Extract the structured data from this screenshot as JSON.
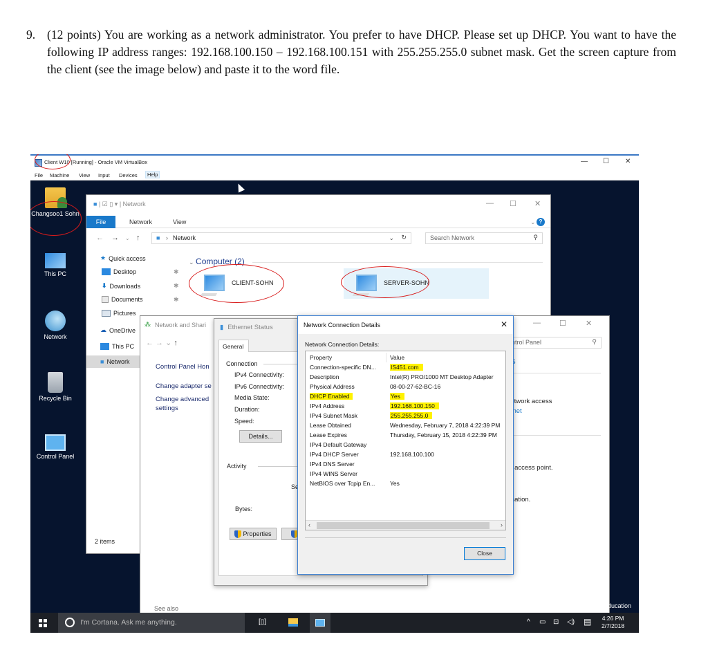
{
  "question": {
    "number": "9.",
    "text": "(12 points) You are working as a network administrator. You prefer to have DHCP. Please set up DHCP. You want to have the following IP address ranges: 192.168.100.150 – 192.168.100.151 with 255.255.255.0 subnet mask. Get the screen capture from the client (see the image below) and paste it to the word file."
  },
  "virtualbox": {
    "title": "Client W10 [Running] - Oracle VM VirtualBox",
    "menu": [
      "File",
      "Machine",
      "View",
      "Input",
      "Devices",
      "Help"
    ],
    "controls": {
      "minimize": "—",
      "maximize": "☐",
      "close": "✕"
    }
  },
  "desktop": {
    "icons": [
      {
        "label": "Changsoo1 Sohn",
        "icon": "user-folder-icon"
      },
      {
        "label": "This PC",
        "icon": "computer-icon"
      },
      {
        "label": "Network",
        "icon": "network-icon"
      },
      {
        "label": "Recycle Bin",
        "icon": "recycle-bin-icon"
      },
      {
        "label": "Control Panel",
        "icon": "control-panel-icon"
      }
    ],
    "edition_text": "Education"
  },
  "explorer": {
    "title": "Network",
    "ribbon_tabs": [
      "File",
      "Network",
      "View"
    ],
    "address": "Network",
    "search_placeholder": "Search Network",
    "nav": {
      "quick_access": "Quick access",
      "items": [
        "Desktop",
        "Downloads",
        "Documents",
        "Pictures",
        "OneDrive",
        "This PC",
        "Network"
      ]
    },
    "group_header": "Computer (2)",
    "computers": [
      "CLIENT-SOHN",
      "SERVER-SOHN"
    ],
    "status": "2 items",
    "controls": {
      "minimize": "—",
      "maximize": "☐",
      "close": "✕",
      "help": "?"
    }
  },
  "network_sharing": {
    "title": "Network and Shari",
    "cp_home": "Control Panel Hon",
    "links": [
      "Change adapter se",
      "Change advanced",
      "settings"
    ],
    "search_placeholder": "ntrol Panel",
    "right_texts": [
      "ns",
      "network access",
      "ernet",
      "or access point.",
      "rmation."
    ],
    "see_also": "See also",
    "controls": {
      "minimize": "—",
      "maximize": "☐",
      "close": "✕"
    }
  },
  "ethernet_status": {
    "title": "Ethernet Status",
    "tab": "General",
    "connection_label": "Connection",
    "fields": [
      "IPv4 Connectivity:",
      "IPv6 Connectivity:",
      "Media State:",
      "Duration:",
      "Speed:"
    ],
    "details_button": "Details...",
    "activity_label": "Activity",
    "sent_fragment": "Se",
    "bytes_label": "Bytes:",
    "properties_button": "Properties"
  },
  "details_dialog": {
    "title": "Network Connection Details",
    "subtitle": "Network Connection Details:",
    "columns": [
      "Property",
      "Value"
    ],
    "rows": [
      {
        "property": "Connection-specific DN...",
        "value": "IS451.com",
        "highlight_value": true,
        "highlight_property": false
      },
      {
        "property": "Description",
        "value": "Intel(R) PRO/1000 MT Desktop Adapter",
        "highlight_value": false,
        "highlight_property": false
      },
      {
        "property": "Physical Address",
        "value": "08-00-27-62-BC-16",
        "highlight_value": false,
        "highlight_property": false
      },
      {
        "property": "DHCP Enabled",
        "value": "Yes",
        "highlight_value": true,
        "highlight_property": true
      },
      {
        "property": "IPv4 Address",
        "value": "192.168.100.150",
        "highlight_value": true,
        "highlight_property": false
      },
      {
        "property": "IPv4 Subnet Mask",
        "value": "255.255.255.0",
        "highlight_value": true,
        "highlight_property": false
      },
      {
        "property": "Lease Obtained",
        "value": "Wednesday, February 7, 2018 4:22:39 PM",
        "highlight_value": false,
        "highlight_property": false
      },
      {
        "property": "Lease Expires",
        "value": "Thursday, February 15, 2018 4:22:39 PM",
        "highlight_value": false,
        "highlight_property": false
      },
      {
        "property": "IPv4 Default Gateway",
        "value": "",
        "highlight_value": false,
        "highlight_property": false
      },
      {
        "property": "IPv4 DHCP Server",
        "value": "192.168.100.100",
        "highlight_value": false,
        "highlight_property": false
      },
      {
        "property": "IPv4 DNS Server",
        "value": "",
        "highlight_value": false,
        "highlight_property": false
      },
      {
        "property": "IPv4 WINS Server",
        "value": "",
        "highlight_value": false,
        "highlight_property": false
      },
      {
        "property": "NetBIOS over Tcpip En...",
        "value": "Yes",
        "highlight_value": false,
        "highlight_property": false
      }
    ],
    "close_button": "Close",
    "close_icon": "✕"
  },
  "taskbar": {
    "cortana_placeholder": "I'm Cortana. Ask me anything.",
    "time": "4:26 PM",
    "date": "2/7/2018",
    "tray_icons": [
      "chevron-up-icon",
      "power-icon",
      "network-warning-icon",
      "volume-icon",
      "action-center-icon"
    ]
  },
  "colors": {
    "highlight": "#fff200",
    "annotation_red": "#d81b1b",
    "accent_blue": "#1979ca"
  }
}
